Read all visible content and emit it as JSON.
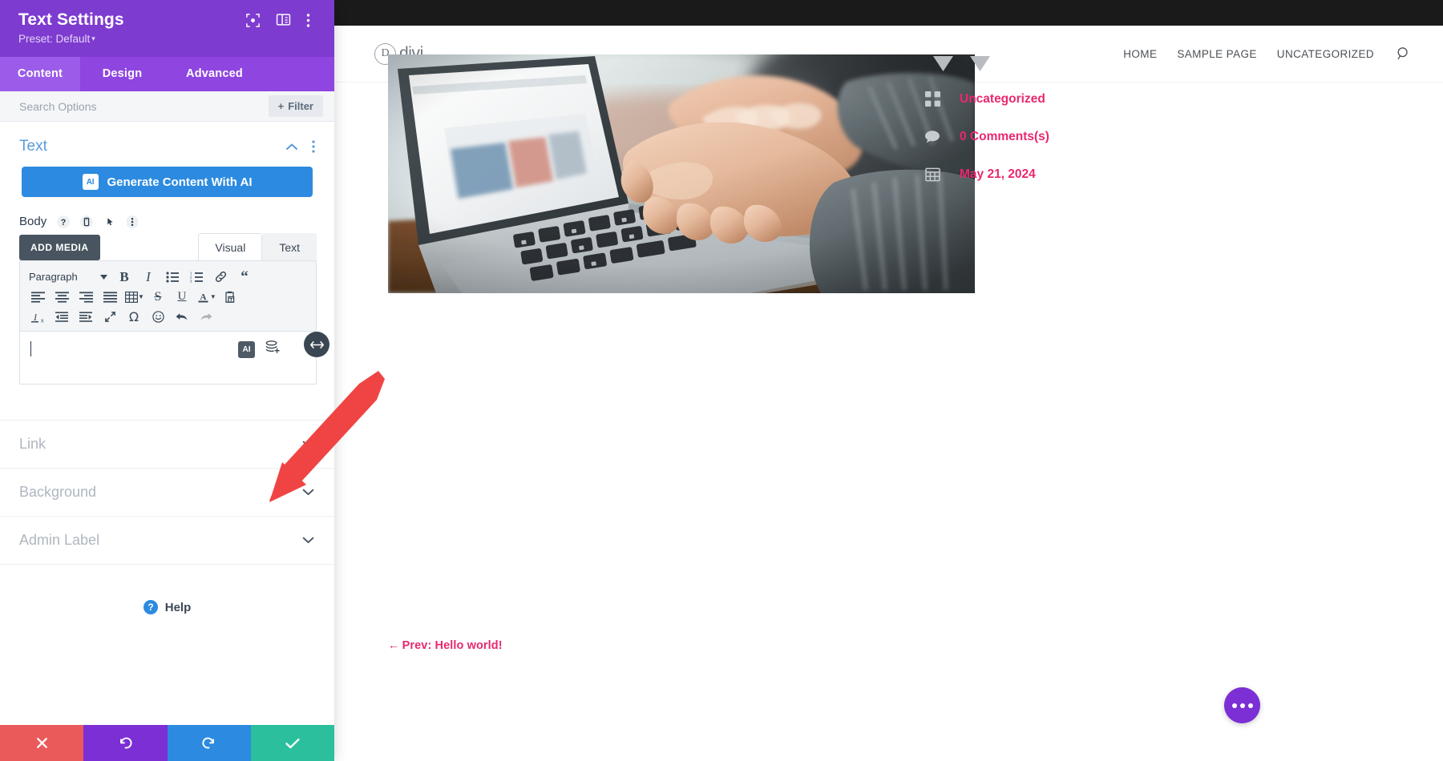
{
  "settings_panel": {
    "title": "Text Settings",
    "preset": "Preset: Default",
    "preset_caret": "▾",
    "header_icons": [
      {
        "name": "focus-target-icon"
      },
      {
        "name": "layout-columns-icon"
      },
      {
        "name": "more-vertical-icon"
      }
    ],
    "tabs": [
      {
        "label": "Content",
        "active": true
      },
      {
        "label": "Design",
        "active": false
      },
      {
        "label": "Advanced",
        "active": false
      }
    ],
    "search": {
      "placeholder": "Search Options",
      "filter_label": "Filter",
      "filter_plus": "+"
    },
    "text_section": {
      "title": "Text",
      "ai_button": {
        "label": "Generate Content With AI",
        "badge": "AI"
      },
      "body_label": "Body",
      "body_icons": [
        "help-icon",
        "mobile-icon",
        "cursor-icon",
        "more-vertical-icon"
      ],
      "add_media_label": "ADD MEDIA",
      "editor_tabs": [
        {
          "label": "Visual",
          "active": true
        },
        {
          "label": "Text",
          "active": false
        }
      ],
      "toolbar": {
        "format_select": "Paragraph",
        "row1": [
          "bold",
          "italic",
          "bulleted-list",
          "numbered-list",
          "link",
          "blockquote"
        ],
        "row2": [
          "align-left",
          "align-center",
          "align-right",
          "align-justify",
          "table",
          "strikethrough",
          "underline",
          "text-color",
          "paste-as-text"
        ],
        "row3": [
          "clear-formatting",
          "outdent",
          "indent",
          "fullscreen",
          "special-character",
          "emoji",
          "undo",
          "redo"
        ]
      },
      "editor_value": "",
      "editor_ai_badge": "AI",
      "editor_layers_icon": "layers-add-icon",
      "resize_handle_icon": "horizontal-resize-icon"
    },
    "accordion": [
      {
        "label": "Link"
      },
      {
        "label": "Background"
      },
      {
        "label": "Admin Label"
      }
    ],
    "help": {
      "label": "Help",
      "icon": "help-circle-icon"
    },
    "footer_buttons": [
      {
        "name": "discard-button",
        "icon": "close-icon",
        "color": "#EA5A5A"
      },
      {
        "name": "undo-button",
        "icon": "undo-icon",
        "color": "#7B2FD4"
      },
      {
        "name": "redo-button",
        "icon": "redo-icon",
        "color": "#2C8BE0"
      },
      {
        "name": "save-button",
        "icon": "check-icon",
        "color": "#2BBF9E"
      }
    ]
  },
  "preview": {
    "brand": {
      "mark": "D",
      "name": "divi"
    },
    "nav": [
      {
        "label": "HOME"
      },
      {
        "label": "SAMPLE PAGE"
      },
      {
        "label": "UNCATEGORIZED"
      }
    ],
    "search_icon": "search-icon",
    "hero_image_alt": "hands-typing-on-laptop-photo",
    "meta": [
      {
        "icon": "grid-icon",
        "text": "Uncategorized"
      },
      {
        "icon": "comment-icon",
        "text": "0 Comments(s)"
      },
      {
        "icon": "calendar-icon",
        "text": "May 21, 2024"
      }
    ],
    "prev_link": {
      "arrow": "←",
      "label": "Prev: Hello world!"
    },
    "fab": {
      "name": "divi-menu-fab",
      "dots": 3
    }
  },
  "annotation": {
    "type": "red-arrow",
    "color": "#F04444",
    "points_to": "editor-ai-badge"
  }
}
